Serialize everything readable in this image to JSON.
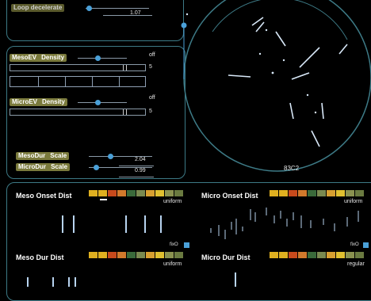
{
  "top_panel": {
    "label": "Loop decelerate",
    "value": "1.07"
  },
  "meso_ev": {
    "label": "MesoEV",
    "param": "Density",
    "toggle_text": "off",
    "number": "5"
  },
  "micro_ev": {
    "label": "MicroEV",
    "param": "Density",
    "toggle_text": "off",
    "number": "5"
  },
  "meso_dur": {
    "label": "MesoDur",
    "param": "Scale",
    "value": "2.04"
  },
  "micro_dur": {
    "label": "MicroDur",
    "param": "Scale",
    "value": "0.99"
  },
  "circle_readout": "83C2",
  "sections": {
    "meso_onset": {
      "title": "Meso Onset Dist",
      "dist": "uniform"
    },
    "micro_onset": {
      "title": "Micro Onset Dist",
      "dist": "uniform"
    },
    "meso_dur": {
      "title": "Meso Dur  Dist",
      "dist": "uniform"
    },
    "micro_dur": {
      "title": "Micro Dur Dist",
      "dist": "regular"
    }
  },
  "fix_label": "fixO",
  "colors": {
    "accent": "#4aa0d8",
    "panel_border": "#3d7a86",
    "tag_bg": "#7a7a3c"
  },
  "palette": [
    "#e0b020",
    "#e0b020",
    "#c84a1c",
    "#d27a2c",
    "#3a6a3a",
    "#7a8a50",
    "#d8a030",
    "#e0c030",
    "#8a9250",
    "#6a7a40"
  ]
}
